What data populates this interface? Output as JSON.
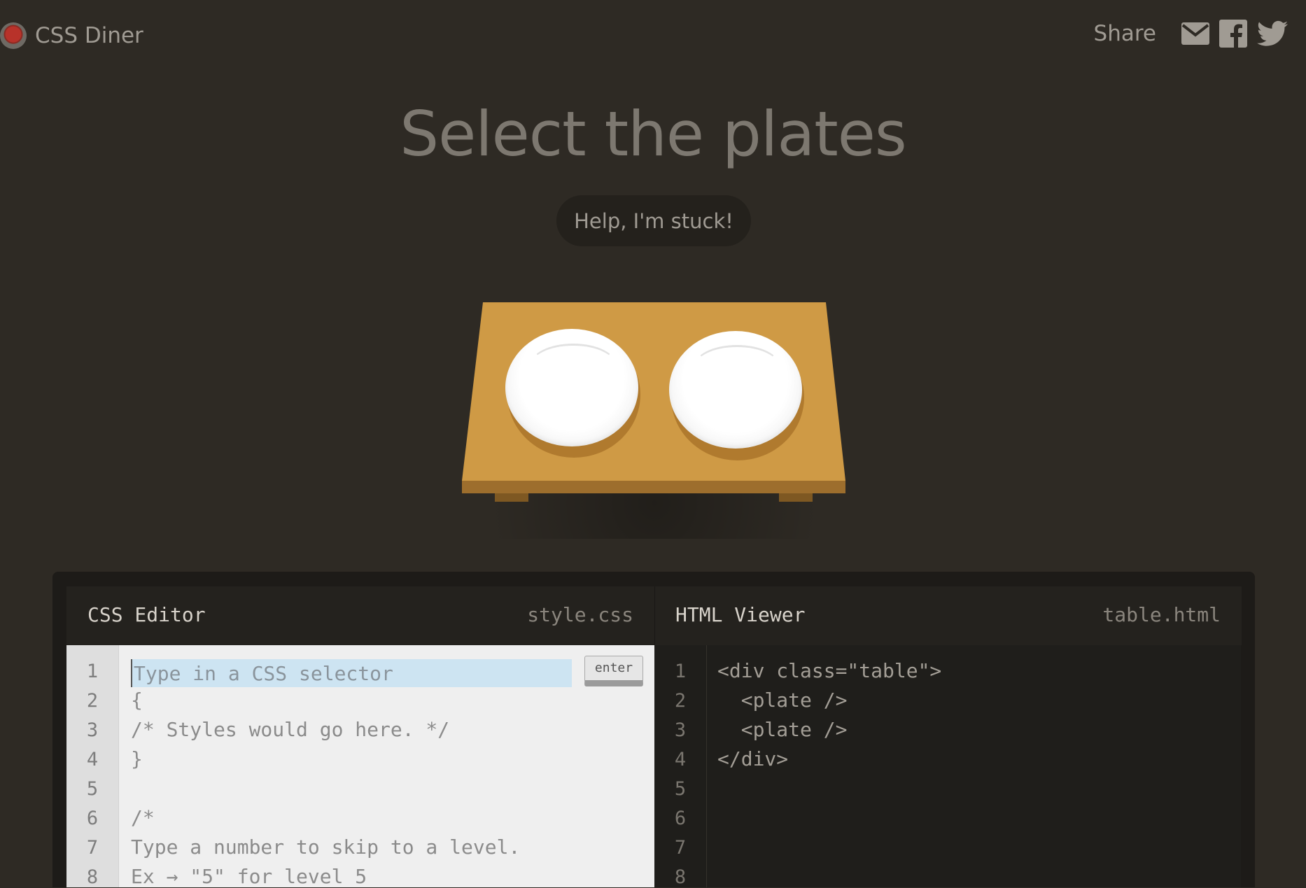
{
  "app": {
    "name": "CSS Diner"
  },
  "share": {
    "label": "Share",
    "icons": [
      "mail-icon",
      "facebook-icon",
      "twitter-icon"
    ]
  },
  "level": {
    "title": "Select the plates",
    "help_label": "Help, I'm stuck!"
  },
  "css_editor": {
    "title": "CSS Editor",
    "filename": "style.css",
    "input_placeholder": "Type in a CSS selector",
    "enter_label": "enter",
    "line_numbers": [
      "1",
      "2",
      "3",
      "4",
      "5",
      "6",
      "7",
      "8"
    ],
    "lines": [
      "{",
      "/* Styles would go here. */",
      "}",
      "",
      "/*",
      "Type a number to skip to a level.",
      "Ex → \"5\" for level 5"
    ]
  },
  "html_viewer": {
    "title": "HTML Viewer",
    "filename": "table.html",
    "line_numbers": [
      "1",
      "2",
      "3",
      "4",
      "5",
      "6",
      "7",
      "8"
    ],
    "lines": [
      "<div class=\"table\">",
      "  <plate />",
      "  <plate />",
      "</div>"
    ]
  },
  "colors": {
    "background": "#2e2a24",
    "table_top": "#cf9a45",
    "plate": "#ffffff",
    "selector_highlight": "#cde4f2"
  }
}
